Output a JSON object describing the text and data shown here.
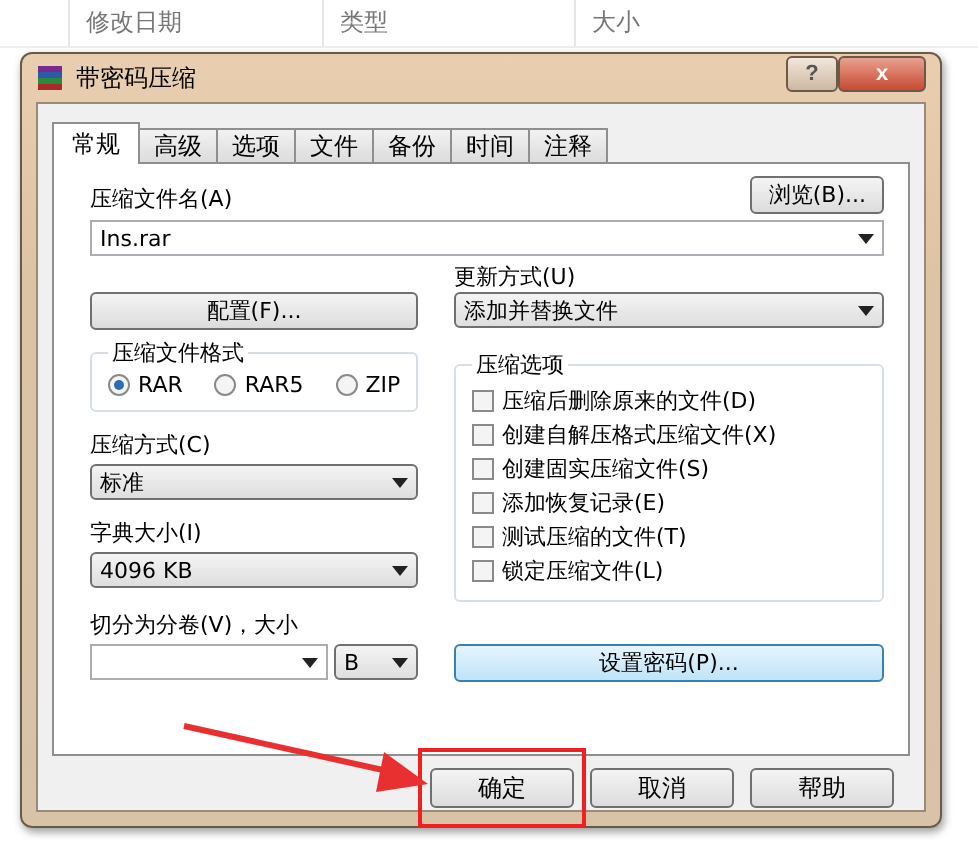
{
  "background_header": {
    "columns": [
      "修改日期",
      "类型",
      "大小"
    ]
  },
  "window": {
    "title": "带密码压缩",
    "help_button": "?",
    "close_button": "x"
  },
  "tabs": [
    {
      "label": "常规",
      "selected": true
    },
    {
      "label": "高级",
      "selected": false
    },
    {
      "label": "选项",
      "selected": false
    },
    {
      "label": "文件",
      "selected": false
    },
    {
      "label": "备份",
      "selected": false
    },
    {
      "label": "时间",
      "selected": false
    },
    {
      "label": "注释",
      "selected": false
    }
  ],
  "archive_name": {
    "label": "压缩文件名(A)",
    "value": "Ins.rar",
    "browse_button": "浏览(B)..."
  },
  "profiles_button": "配置(F)...",
  "update_mode": {
    "label": "更新方式(U)",
    "value": "添加并替换文件"
  },
  "archive_format": {
    "label": "压缩文件格式",
    "options": [
      {
        "label": "RAR",
        "selected": true
      },
      {
        "label": "RAR5",
        "selected": false
      },
      {
        "label": "ZIP",
        "selected": false
      }
    ]
  },
  "compression_method": {
    "label": "压缩方式(C)",
    "value": "标准"
  },
  "dictionary_size": {
    "label": "字典大小(I)",
    "value": "4096 KB"
  },
  "split_volumes": {
    "label": "切分为分卷(V)，大小",
    "unit": "B"
  },
  "archiving_options": {
    "label": "压缩选项",
    "items": [
      {
        "label": "压缩后删除原来的文件(D)",
        "checked": false
      },
      {
        "label": "创建自解压格式压缩文件(X)",
        "checked": false
      },
      {
        "label": "创建固实压缩文件(S)",
        "checked": false
      },
      {
        "label": "添加恢复记录(E)",
        "checked": false
      },
      {
        "label": "测试压缩的文件(T)",
        "checked": false
      },
      {
        "label": "锁定压缩文件(L)",
        "checked": false
      }
    ]
  },
  "password_button": "设置密码(P)...",
  "buttons": [
    {
      "label": "确定",
      "highlighted": true
    },
    {
      "label": "取消",
      "highlighted": false
    },
    {
      "label": "帮助",
      "highlighted": false
    }
  ]
}
